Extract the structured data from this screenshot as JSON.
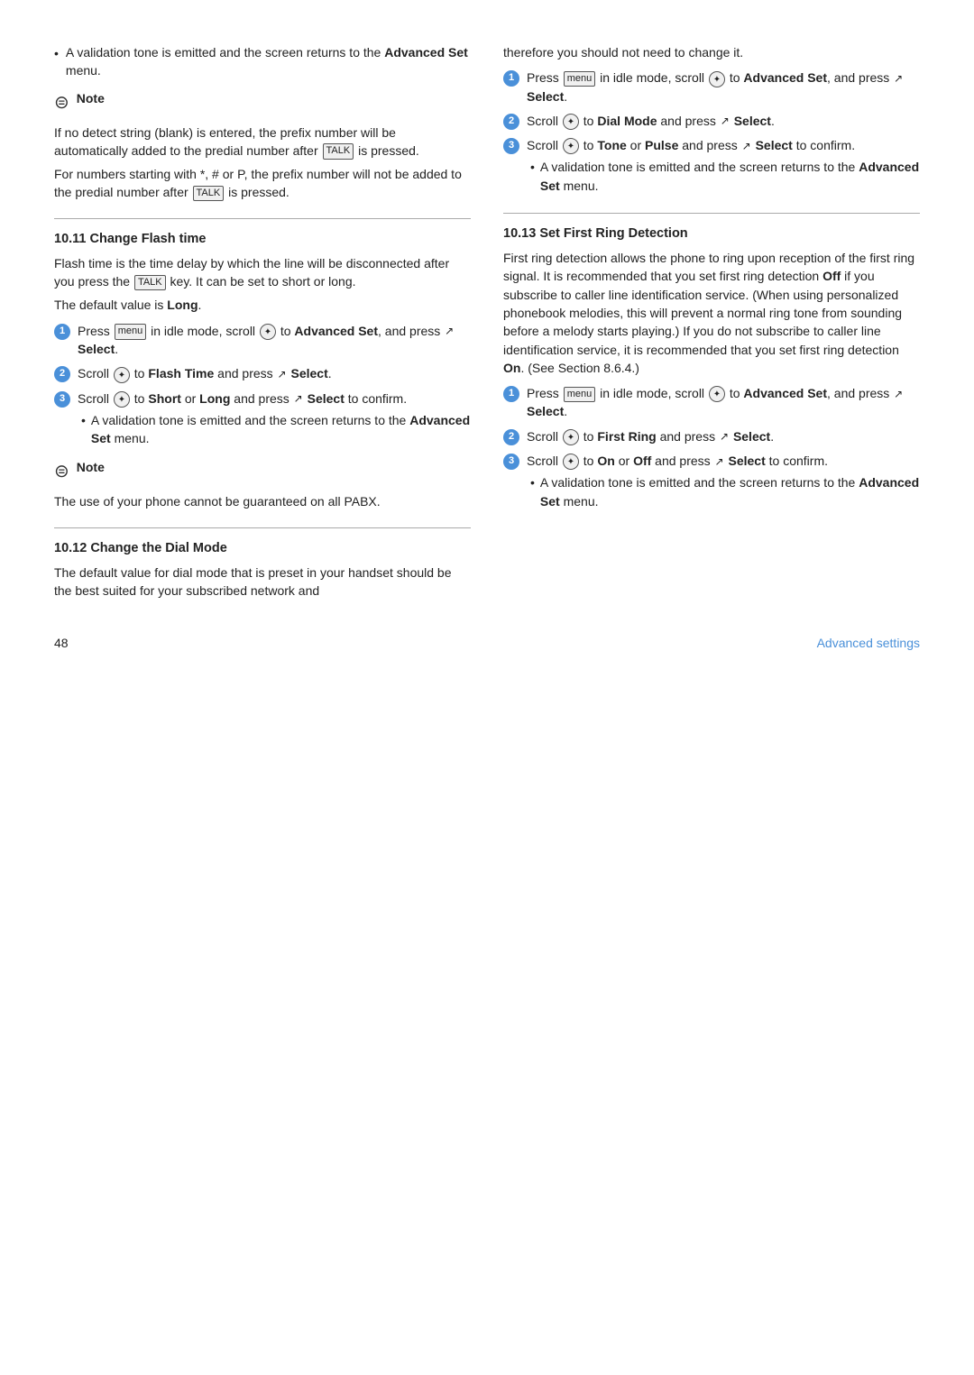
{
  "page": {
    "number": "48",
    "footer_title": "Advanced settings"
  },
  "left_col": {
    "intro_bullets": [
      {
        "text_parts": [
          {
            "text": "A validation tone is emitted and the screen returns to the "
          },
          {
            "text": "Advanced Set",
            "bold": true
          },
          {
            "text": " menu."
          }
        ]
      }
    ],
    "note1": {
      "label": "Note",
      "text": "If no detect string (blank) is entered, the prefix number will be automatically added to the predial number after  is pressed.\nFor numbers starting with *, # or P, the prefix number will not be added to the predial number after  is pressed."
    },
    "section_10_11": {
      "title": "10.11  Change Flash time",
      "intro": "Flash time is the time delay by which the line will be disconnected after you press the  key. It can be set to short or long.",
      "default": "The default value is ",
      "default_bold": "Long",
      "default_end": ".",
      "steps": [
        {
          "num": "1",
          "parts": [
            {
              "text": "Press "
            },
            {
              "text": "menu",
              "key": true
            },
            {
              "text": " in idle mode, scroll "
            },
            {
              "text": "◉",
              "scroll": true
            },
            {
              "text": " to "
            },
            {
              "text": "Advanced Set",
              "bold": true
            },
            {
              "text": ", and press "
            },
            {
              "text": "↗",
              "select": true
            },
            {
              "text": " "
            },
            {
              "text": "Select",
              "bold": true
            },
            {
              "text": "."
            }
          ]
        },
        {
          "num": "2",
          "parts": [
            {
              "text": "Scroll "
            },
            {
              "text": "◉",
              "scroll": true
            },
            {
              "text": " to "
            },
            {
              "text": "Flash Time",
              "bold": true
            },
            {
              "text": " and press "
            },
            {
              "text": "↗",
              "select": true
            },
            {
              "text": " "
            },
            {
              "text": "Select",
              "bold": true
            },
            {
              "text": "."
            }
          ]
        },
        {
          "num": "3",
          "parts": [
            {
              "text": "Scroll "
            },
            {
              "text": "◉",
              "scroll": true
            },
            {
              "text": " to "
            },
            {
              "text": "Short",
              "bold": true
            },
            {
              "text": " or "
            },
            {
              "text": "Long",
              "bold": true
            },
            {
              "text": " and press "
            },
            {
              "text": "↗",
              "select": true
            },
            {
              "text": " "
            },
            {
              "text": "Select",
              "bold": true
            },
            {
              "text": " to confirm."
            }
          ],
          "sub_bullet": [
            {
              "text": "A validation tone is emitted and the screen returns to the "
            },
            {
              "text": "Advanced Set",
              "bold": true
            },
            {
              "text": " menu."
            }
          ]
        }
      ]
    },
    "note2": {
      "label": "Note",
      "text": "The use of your phone cannot be guaranteed on all PABX."
    },
    "section_10_12": {
      "title": "10.12  Change the Dial Mode",
      "intro": "The default value for dial mode that is preset in your handset should be the best suited for your subscribed network and"
    }
  },
  "right_col": {
    "intro_text": "therefore you should not need to change it.",
    "steps_dial_mode": [
      {
        "num": "1",
        "parts": [
          {
            "text": "Press "
          },
          {
            "text": "menu",
            "key": true
          },
          {
            "text": " in idle mode, scroll "
          },
          {
            "text": "◉",
            "scroll": true
          },
          {
            "text": " to "
          },
          {
            "text": "Advanced Set",
            "bold": true
          },
          {
            "text": ", and press "
          },
          {
            "text": "↗",
            "select": true
          },
          {
            "text": " "
          },
          {
            "text": "Select",
            "bold": true
          },
          {
            "text": "."
          }
        ]
      },
      {
        "num": "2",
        "parts": [
          {
            "text": "Scroll "
          },
          {
            "text": "◉",
            "scroll": true
          },
          {
            "text": " to "
          },
          {
            "text": "Dial Mode",
            "bold": true
          },
          {
            "text": " and press "
          },
          {
            "text": "↗",
            "select": true
          },
          {
            "text": " "
          },
          {
            "text": "Select",
            "bold": true
          },
          {
            "text": "."
          }
        ]
      },
      {
        "num": "3",
        "parts": [
          {
            "text": "Scroll "
          },
          {
            "text": "◉",
            "scroll": true
          },
          {
            "text": " to "
          },
          {
            "text": "Tone",
            "bold": true
          },
          {
            "text": " or "
          },
          {
            "text": "Pulse",
            "bold": true
          },
          {
            "text": " and press "
          },
          {
            "text": "↗",
            "select": true
          },
          {
            "text": " "
          },
          {
            "text": "Select",
            "bold": true
          },
          {
            "text": " to confirm."
          }
        ],
        "sub_bullet": [
          {
            "text": "A validation tone is emitted and the screen returns to the "
          },
          {
            "text": "Advanced Set",
            "bold": true
          },
          {
            "text": " menu."
          }
        ]
      }
    ],
    "section_10_13": {
      "title": "10.13  Set First Ring Detection",
      "intro": "First ring detection allows the phone to ring upon reception of the first ring signal. It is recommended that you set first ring detection ",
      "intro_bold": "Off",
      "intro2": " if you subscribe to caller line identification service. (When using personalized phonebook melodies, this will prevent a normal ring tone from sounding before a melody starts playing.) If you do not subscribe to caller line identification service, it is recommended that you set first ring detection ",
      "intro2_bold": "On",
      "intro2_end": ". (See Section 8.6.4.)",
      "steps": [
        {
          "num": "1",
          "parts": [
            {
              "text": "Press "
            },
            {
              "text": "menu",
              "key": true
            },
            {
              "text": " in idle mode, scroll "
            },
            {
              "text": "◉",
              "scroll": true
            },
            {
              "text": " to "
            },
            {
              "text": "Advanced Set",
              "bold": true
            },
            {
              "text": ", and press "
            },
            {
              "text": "↗",
              "select": true
            },
            {
              "text": " "
            },
            {
              "text": "Select",
              "bold": true
            },
            {
              "text": "."
            }
          ]
        },
        {
          "num": "2",
          "parts": [
            {
              "text": "Scroll "
            },
            {
              "text": "◉",
              "scroll": true
            },
            {
              "text": " to "
            },
            {
              "text": "First Ring",
              "bold": true
            },
            {
              "text": " and press "
            },
            {
              "text": "↗",
              "select": true
            },
            {
              "text": " "
            },
            {
              "text": "Select",
              "bold": true
            },
            {
              "text": "."
            }
          ]
        },
        {
          "num": "3",
          "parts": [
            {
              "text": "Scroll "
            },
            {
              "text": "◉",
              "scroll": true
            },
            {
              "text": " to "
            },
            {
              "text": "On",
              "bold": true
            },
            {
              "text": " or "
            },
            {
              "text": "Off",
              "bold": true
            },
            {
              "text": " and press "
            },
            {
              "text": "↗",
              "select": true
            },
            {
              "text": " "
            },
            {
              "text": "Select",
              "bold": true
            },
            {
              "text": " to confirm."
            }
          ],
          "sub_bullet": [
            {
              "text": "A validation tone is emitted and the screen returns to the "
            },
            {
              "text": "Advanced Set",
              "bold": true
            },
            {
              "text": " menu."
            }
          ]
        }
      ]
    }
  }
}
